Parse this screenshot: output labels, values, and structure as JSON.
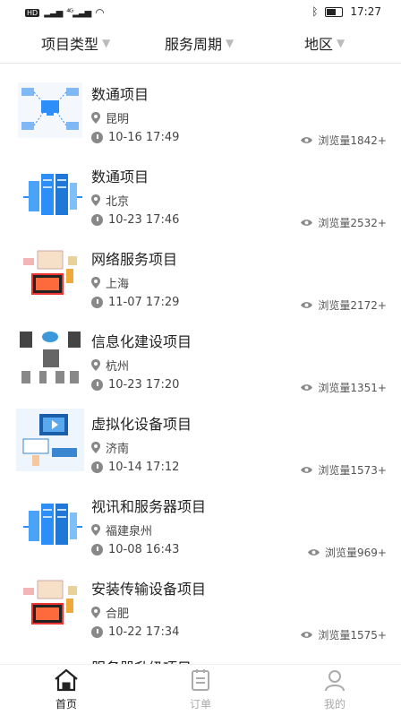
{
  "status": {
    "time": "17:27",
    "left_text": "HD ⁴G"
  },
  "filters": [
    {
      "label": "项目类型"
    },
    {
      "label": "服务周期"
    },
    {
      "label": "地区"
    }
  ],
  "items": [
    {
      "title": "数通项目",
      "location": "昆明",
      "time": "10-16 17:49",
      "views": "浏览量1842+",
      "thumb": "network-diagram"
    },
    {
      "title": "数通项目",
      "location": "北京",
      "time": "10-23 17:46",
      "views": "浏览量2532+",
      "thumb": "server-racks"
    },
    {
      "title": "网络服务项目",
      "location": "上海",
      "time": "11-07 17:29",
      "views": "浏览量2172+",
      "thumb": "devices"
    },
    {
      "title": "信息化建设项目",
      "location": "杭州",
      "time": "10-23 17:20",
      "views": "浏览量1351+",
      "thumb": "cloud-infra"
    },
    {
      "title": "虚拟化设备项目",
      "location": "济南",
      "time": "10-14 17:12",
      "views": "浏览量1573+",
      "thumb": "computer-screen"
    },
    {
      "title": "视讯和服务器项目",
      "location": "福建泉州",
      "time": "10-08 16:43",
      "views": "浏览量969+",
      "thumb": "server-racks"
    },
    {
      "title": "安装传输设备项目",
      "location": "合肥",
      "time": "10-22 17:34",
      "views": "浏览量1575+",
      "thumb": "devices"
    }
  ],
  "partial_item": {
    "title": "服务器升级项目"
  },
  "tabs": [
    {
      "label": "首页",
      "icon": "home-icon",
      "active": true
    },
    {
      "label": "订单",
      "icon": "clipboard-icon",
      "active": false
    },
    {
      "label": "我的",
      "icon": "user-icon",
      "active": false
    }
  ],
  "colors": {
    "accent_blue": "#2c8ef8",
    "icon_gray": "#888888",
    "active_tab": "#222222"
  }
}
